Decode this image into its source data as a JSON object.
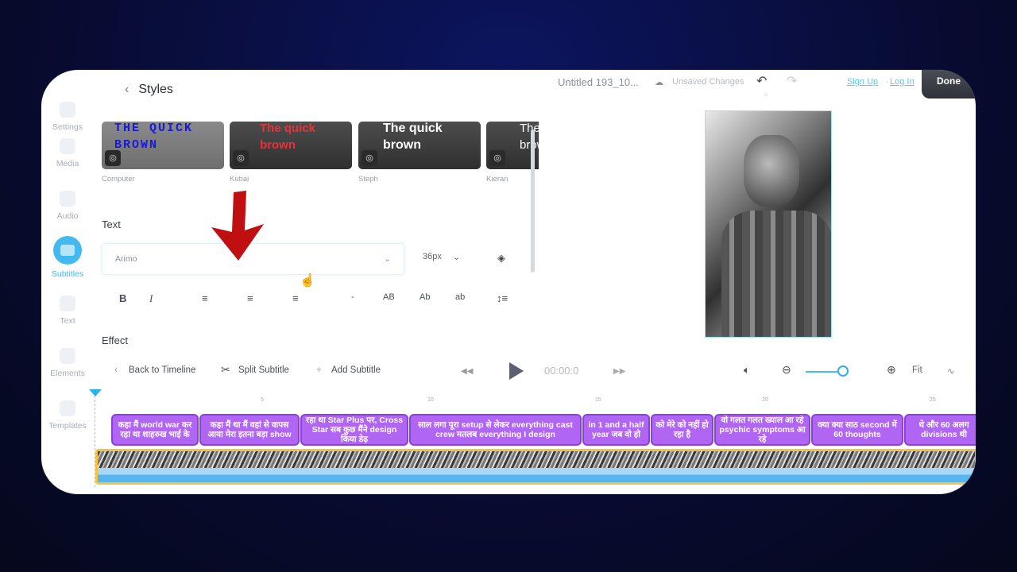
{
  "header": {
    "project_title": "Untitled 193_10...",
    "save_status": "Unsaved Changes",
    "sign_up": "Sign Up",
    "separator": "·",
    "log_in": "Log In",
    "done": "Done"
  },
  "sidebar": {
    "items": [
      {
        "label": "Settings",
        "icon": "settings-icon",
        "active": false
      },
      {
        "label": "Media",
        "icon": "media-icon",
        "active": false
      },
      {
        "label": "Audio",
        "icon": "audio-icon",
        "active": false
      },
      {
        "label": "Subtitles",
        "icon": "subtitles-icon",
        "active": true
      },
      {
        "label": "Text",
        "icon": "text-icon",
        "active": false
      },
      {
        "label": "Elements",
        "icon": "elements-icon",
        "active": false
      },
      {
        "label": "Templates",
        "icon": "templates-icon",
        "active": false
      }
    ]
  },
  "panel": {
    "title": "Styles",
    "styles": [
      {
        "name": "Computer",
        "sample": "THE QUICK BROWN",
        "color": "#1a1ad6"
      },
      {
        "name": "Kubai",
        "sample": "The quick brown",
        "color": "#e8323a"
      },
      {
        "name": "Steph",
        "sample": "The quick brown",
        "color": "#ffffff"
      },
      {
        "name": "Kieran",
        "sample": "The brown",
        "color": "#ffffff"
      }
    ],
    "text_section": "Text",
    "font": "Arimo",
    "font_size": "36px",
    "format_buttons": [
      "B",
      "I",
      "align-left",
      "align-center",
      "align-right",
      "-",
      "AB",
      "Ab",
      "ab",
      "line-height"
    ],
    "effect_section": "Effect"
  },
  "timeline": {
    "back": "Back to Timeline",
    "split": "Split Subtitle",
    "add": "Add Subtitle",
    "time": "00:00:0",
    "zoom_level": 0.85,
    "fit": "Fit",
    "ruler": [
      "5",
      "10",
      "15",
      "20",
      "25"
    ],
    "subtitles": [
      "कहा मैं world war कर रहा था शाहरुख भाई के",
      "कहा मैं था मैं वहां से वापस आया मेरा इतना बड़ा show",
      "रहा था Star Plus पर, Cross Star सब कुछ मैंने design किया डेढ़",
      "साल लगा पूरा setup से लेकर everything cast crew मतलब everything I design",
      "in 1 and a half year जब वो हो",
      "को मेरे को नहीं हो रहा है",
      "वो गलत गलत ख्याल आ रहे psychic symptoms आ रहे",
      "क्या क्या साठ second में 60 thoughts",
      "थे और 60 अलग divisions थी"
    ]
  }
}
